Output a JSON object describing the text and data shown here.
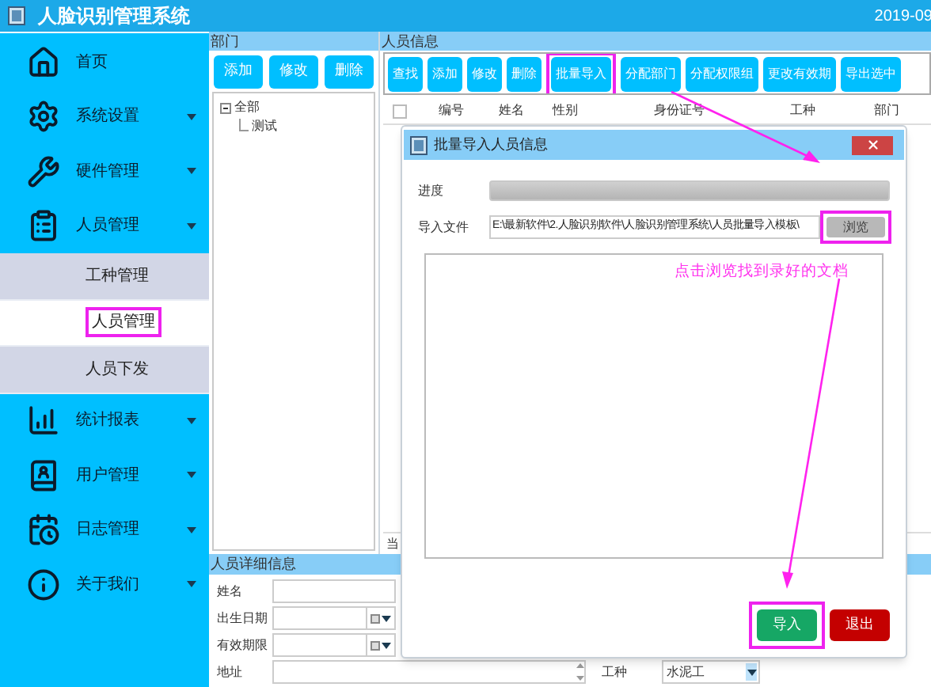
{
  "window": {
    "title": "人脸识别管理系统",
    "date": "2019-09"
  },
  "sidebar": {
    "items": [
      {
        "label": "首页",
        "expandable": false
      },
      {
        "label": "系统设置",
        "expandable": true
      },
      {
        "label": "硬件管理",
        "expandable": true
      },
      {
        "label": "人员管理",
        "expandable": true,
        "children": [
          {
            "label": "工种管理",
            "selected": false,
            "highlighted": false
          },
          {
            "label": "人员管理",
            "selected": true,
            "highlighted": true
          },
          {
            "label": "人员下发",
            "selected": false,
            "highlighted": false
          }
        ]
      },
      {
        "label": "统计报表",
        "expandable": true
      },
      {
        "label": "用户管理",
        "expandable": true
      },
      {
        "label": "日志管理",
        "expandable": true
      },
      {
        "label": "关于我们",
        "expandable": true
      }
    ]
  },
  "departments": {
    "title": "部门",
    "buttons": [
      "添加",
      "修改",
      "删除"
    ],
    "tree": [
      {
        "label": "全部",
        "expanded": true,
        "children": [
          {
            "label": "测试"
          }
        ]
      }
    ]
  },
  "people": {
    "title": "人员信息",
    "toolbar": [
      {
        "label": "查找",
        "highlighted": false
      },
      {
        "label": "添加",
        "highlighted": false
      },
      {
        "label": "修改",
        "highlighted": false
      },
      {
        "label": "删除",
        "highlighted": false
      },
      {
        "label": "批量导入",
        "highlighted": true
      },
      {
        "label": "分配部门",
        "highlighted": false
      },
      {
        "label": "分配权限组",
        "highlighted": false
      },
      {
        "label": "更改有效期",
        "highlighted": false
      },
      {
        "label": "导出选中",
        "highlighted": false
      }
    ],
    "select_all": {
      "checked": false
    },
    "columns": [
      "编号",
      "姓名",
      "性别",
      "身份证号",
      "工种",
      "部门"
    ],
    "footer": "当"
  },
  "import_dialog": {
    "title": "批量导入人员信息",
    "progress": {
      "label": "进度",
      "level": 0
    },
    "file": {
      "label": "导入文件",
      "value": "E:\\最新软件\\2.人脸识别软件\\人脸识别管理系统\\人员批量导入模板\\"
    },
    "browse": {
      "label": "浏览",
      "highlighted": true
    },
    "buttons": [
      {
        "label": "导入",
        "kind": "primary",
        "highlighted": true
      },
      {
        "label": "退出",
        "kind": "danger",
        "highlighted": false
      }
    ]
  },
  "details": {
    "title": "人员详细信息",
    "fields": [
      {
        "label": "姓名",
        "kind": "text"
      },
      {
        "label": "出生日期",
        "kind": "date"
      },
      {
        "label": "有效期限",
        "kind": "date"
      },
      {
        "label": "地址",
        "kind": "textarea"
      },
      {
        "label": "工种",
        "kind": "select",
        "value": "水泥工"
      }
    ]
  },
  "annotation": {
    "text": "点击浏览找到录好的文档"
  }
}
